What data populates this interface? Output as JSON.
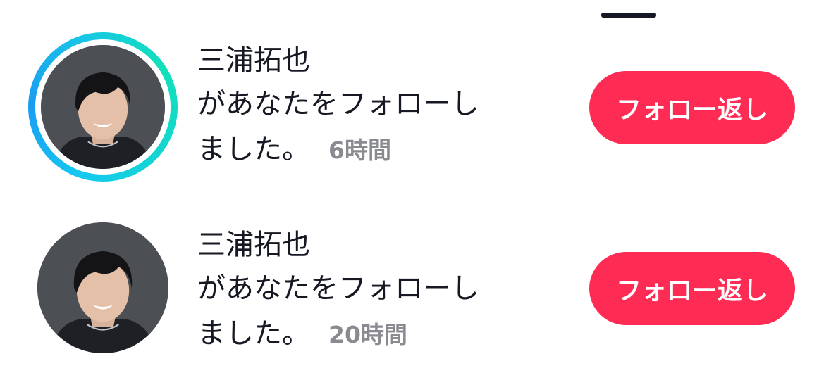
{
  "notifications": [
    {
      "username": "三浦拓也",
      "message_line1": "があなたをフォローし",
      "message_line2": "ました。",
      "time": "6時間",
      "button_label": "フォロー返し",
      "story_ring": true
    },
    {
      "username": "三浦拓也",
      "message_line1": "があなたをフォローし",
      "message_line2": "ました。",
      "time": "20時間",
      "button_label": "フォロー返し",
      "story_ring": false
    }
  ],
  "colors": {
    "follow_button": "#fe2c55",
    "story_ring_start": "#1b9bf2",
    "story_ring_end": "#11e0b9",
    "timestamp": "#8a8b91",
    "text": "#161823"
  },
  "icons": {
    "avatar": "profile-photo"
  }
}
